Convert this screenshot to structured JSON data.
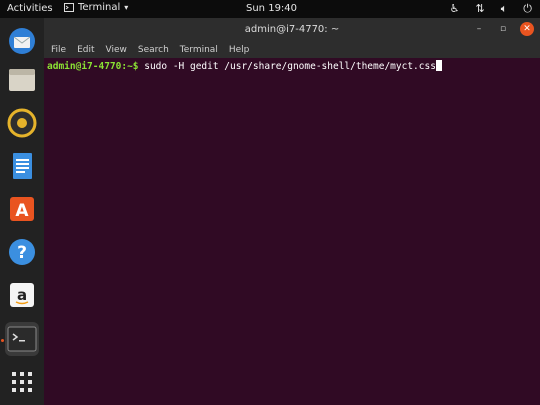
{
  "topbar": {
    "activities": "Activities",
    "app_name": "Terminal",
    "clock": "Sun 19:40"
  },
  "dock": {
    "items": [
      "thunderbird",
      "files",
      "rhythmbox",
      "writer",
      "software",
      "help",
      "amazon",
      "terminal",
      "show-apps"
    ]
  },
  "window": {
    "title": "admin@i7-4770: ~",
    "menu": [
      "File",
      "Edit",
      "View",
      "Search",
      "Terminal",
      "Help"
    ]
  },
  "terminal": {
    "prompt": "admin@i7-4770:~$",
    "command": " sudo -H gedit /usr/share/gnome-shell/theme/myct.css"
  },
  "colors": {
    "accent": "#e95420",
    "terminal_bg": "#300a24",
    "prompt": "#8ae234"
  }
}
